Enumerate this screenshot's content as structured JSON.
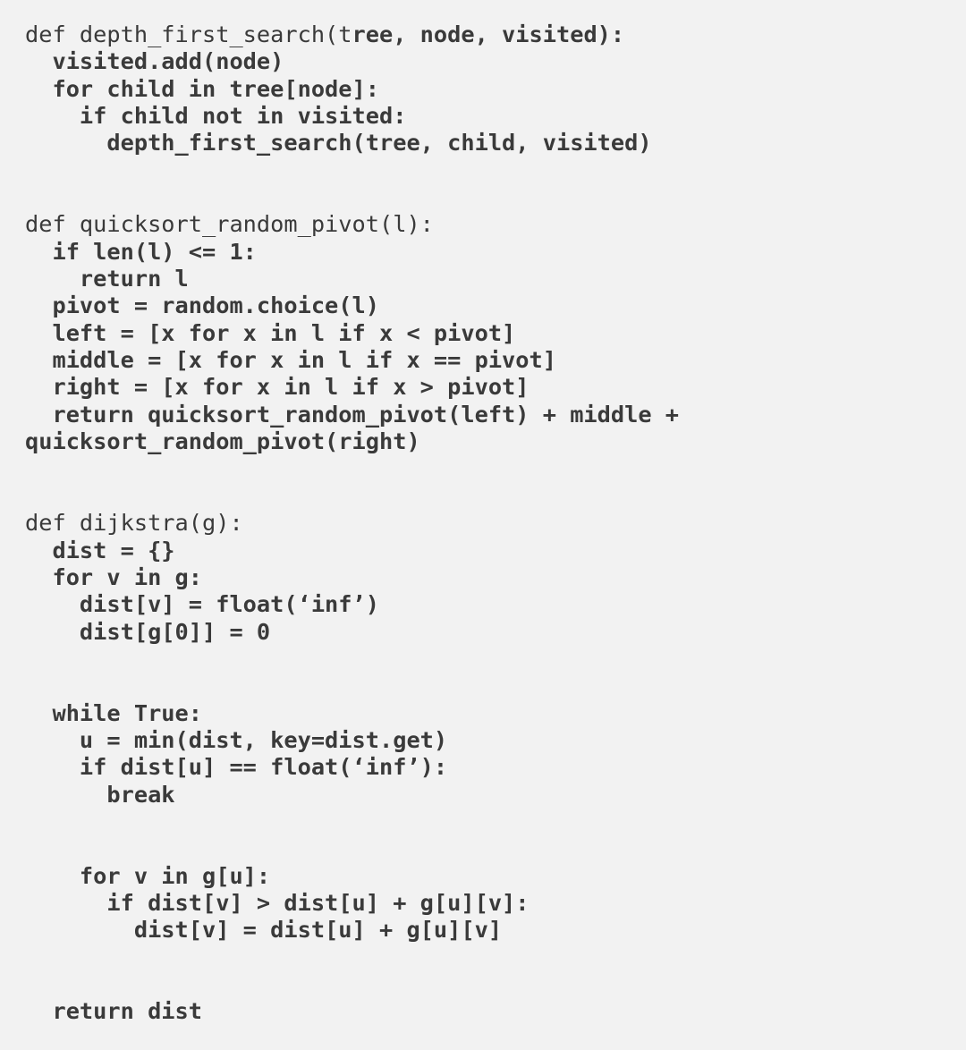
{
  "code": {
    "func_dfs": {
      "def_prefix": "def depth_first_search(t",
      "def_suffix_bold": "ree, node, visited):",
      "body": "  visited.add(node)\n  for child in tree[node]:\n    if child not in visited:\n      depth_first_search(tree, child, visited)"
    },
    "func_qsort": {
      "def": "def quicksort_random_pivot(l):",
      "body": "  if len(l) <= 1:\n    return l\n  pivot = random.choice(l)\n  left = [x for x in l if x < pivot]\n  middle = [x for x in l if x == pivot]\n  right = [x for x in l if x > pivot]\n  return quicksort_random_pivot(left) + middle +\nquicksort_random_pivot(right)"
    },
    "func_dijkstra": {
      "def": "def dijkstra(g):",
      "body1": "  dist = {}\n  for v in g:\n    dist[v] = float(‘inf’)\n    dist[g[0]] = 0",
      "body2": "  while True:\n    u = min(dist, key=dist.get)\n    if dist[u] == float(‘inf’):\n      break",
      "body3": "    for v in g[u]:\n      if dist[v] > dist[u] + g[u][v]:\n        dist[v] = dist[u] + g[u][v]",
      "body4": "  return dist"
    }
  }
}
